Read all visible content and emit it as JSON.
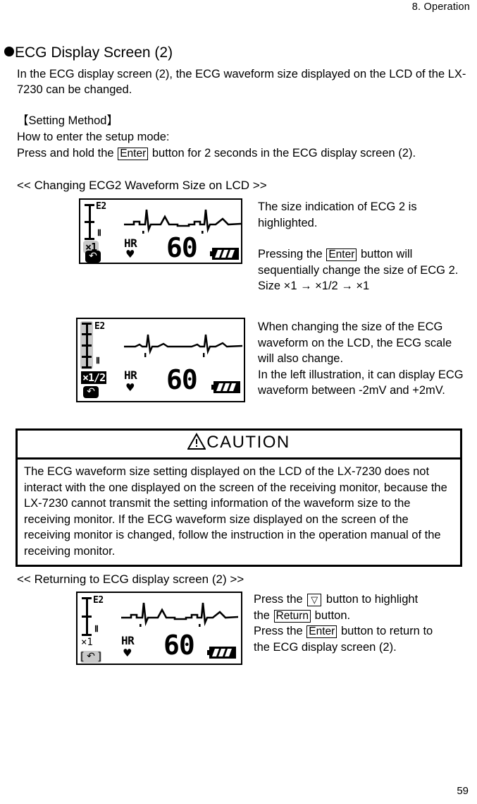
{
  "header": {
    "chapter": "8.  Operation"
  },
  "section": {
    "title": "ECG Display Screen (2)",
    "intro": "In the ECG display screen (2), the ECG waveform size displayed on the LCD of the LX-7230 can be changed.",
    "setting_method_title": "【Setting Method】",
    "setting_line1": "How to enter the setup mode:",
    "setting_line2_pre": "Press and hold the",
    "setting_line2_key": "Enter",
    "setting_line2_post": "button for 2 seconds in the ECG display screen (2)."
  },
  "caption_changing": "<< Changing ECG2 Waveform Size on LCD >>",
  "caption_returning": "<< Returning to ECG display screen (2) >>",
  "lcd1": {
    "channel_label": "E2",
    "lead_label": "Ⅱ",
    "size_indicator": "×1",
    "size_indicator_state": "highlighted-grey",
    "hr_label": "HR",
    "heart_icon": "heart-icon",
    "hr_value": "60",
    "battery_icon": "battery-icon",
    "return_icon": "return-icon"
  },
  "lcd2": {
    "channel_label": "E2",
    "lead_label": "Ⅱ",
    "size_indicator": "×1/2",
    "size_indicator_state": "inverted",
    "hr_label": "HR",
    "heart_icon": "heart-icon",
    "hr_value": "60",
    "battery_icon": "battery-icon",
    "return_icon": "return-icon"
  },
  "lcd3": {
    "channel_label": "E2",
    "lead_label": "Ⅱ",
    "size_indicator": "×1",
    "size_indicator_state": "plain",
    "hr_label": "HR",
    "heart_icon": "heart-icon",
    "hr_value": "60",
    "battery_icon": "battery-icon",
    "return_icon": "return-icon-highlighted"
  },
  "side1": {
    "p1": "The size indication of ECG 2 is highlighted.",
    "p2_pre": "Pressing the",
    "p2_key": "Enter",
    "p2_post": "button will sequentially change the size of ECG 2.",
    "p3": "Size ×1 → ×1/2 → ×1"
  },
  "side2": {
    "p1": "When changing the size of the ECG waveform on the LCD, the ECG scale will also change.",
    "p2": "In the left illustration, it can display ECG waveform between -2mV and +2mV."
  },
  "side3": {
    "l1_pre": "Press the",
    "l1_key": "▽",
    "l1_mid": "button to highlight",
    "l2_pre": "the",
    "l2_key": "Return",
    "l2_post": "button.",
    "l3_pre": "Press the",
    "l3_key": "Enter",
    "l3_post": "button to return to",
    "l4": "the ECG display screen (2)."
  },
  "caution": {
    "heading": "CAUTION",
    "warning_icon": "warning-triangle-icon",
    "body": "The ECG waveform size setting displayed on the LCD of the LX-7230 does not interact with the one displayed on the screen of the receiving monitor, because the LX-7230 cannot transmit the setting information of the waveform size to the receiving monitor. If the ECG waveform size displayed on the screen of the receiving monitor is changed, follow the instruction in the operation manual of the receiving monitor."
  },
  "page_number": "59"
}
